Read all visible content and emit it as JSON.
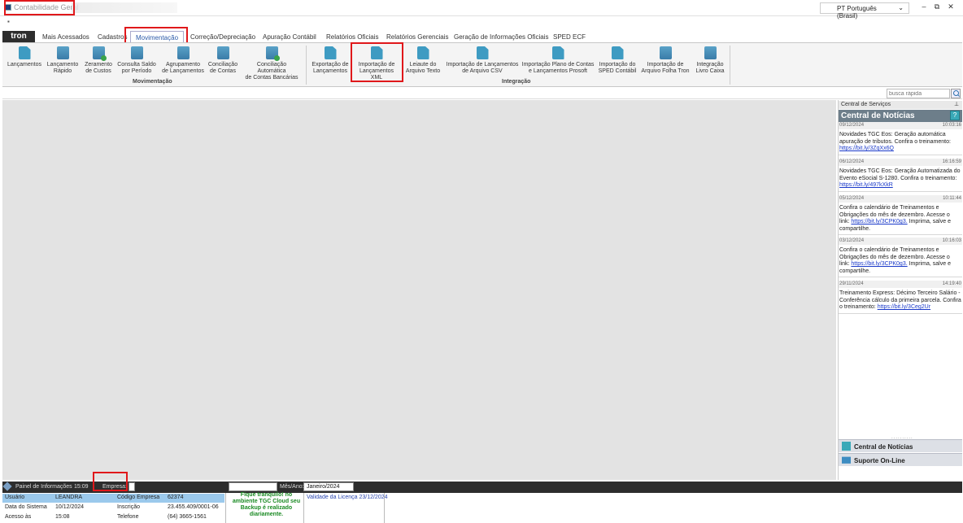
{
  "window": {
    "title": "Contabilidade Geral",
    "language": "PT Português (Brasil)",
    "minimize": "–",
    "restore": "⧉",
    "close": "✕"
  },
  "brand": "tron",
  "tabs": [
    {
      "label": "Mais Acessados"
    },
    {
      "label": "Cadastros"
    },
    {
      "label": "Movimentação",
      "active": true
    },
    {
      "label": "Correção/Depreciação"
    },
    {
      "label": "Apuração Contábil"
    },
    {
      "label": "Relatórios Oficiais"
    },
    {
      "label": "Relatórios Gerenciais"
    },
    {
      "label": "Geração de Informações Oficiais"
    },
    {
      "label": "SPED ECF"
    }
  ],
  "ribbon": {
    "movimentacao": {
      "label": "Movimentação",
      "buttons": [
        {
          "label": "Lançamentos",
          "icon": "lancamentos-icon"
        },
        {
          "label": "Lançamento\nRápido",
          "icon": "lancamento-rapido-icon"
        },
        {
          "label": "Zeramento\nde Custos",
          "icon": "zeramento-icon"
        },
        {
          "label": "Consulta Saldo\npor Período",
          "icon": "calendar-icon"
        },
        {
          "label": "Agrupamento\nde Lançamentos",
          "icon": "agrupamento-icon"
        },
        {
          "label": "Conciliação\nde Contas",
          "icon": "conciliacao-icon"
        },
        {
          "label": "Conciliação Automática\nde Contas Bancárias",
          "icon": "conciliacao-auto-icon"
        }
      ]
    },
    "integracao": {
      "label": "Integração",
      "buttons": [
        {
          "label": "Exportação de\nLançamentos",
          "icon": "exportacao-icon"
        },
        {
          "label": "Importação de\nLançamentos XML",
          "icon": "xml-icon"
        },
        {
          "label": "Leiaute do\nArquivo Texto",
          "icon": "txt-icon"
        },
        {
          "label": "Importação de Lançamentos\nde Arquivo CSV",
          "icon": "csv-icon"
        },
        {
          "label": "Importação Plano de Contas\ne Lançamentos Prosoft",
          "icon": "prosoft-icon"
        },
        {
          "label": "Importação do\nSPED Contábil",
          "icon": "sped-icon"
        },
        {
          "label": "Importação de\nArquivo Folha Tron",
          "icon": "folha-icon"
        },
        {
          "label": "Integração\nLivro Caixa",
          "icon": "livro-caixa-icon"
        }
      ]
    }
  },
  "quick_search": {
    "placeholder": "busca rápida"
  },
  "services": {
    "header": "Central de Serviços",
    "news_title": "Central de Notícias",
    "help_glyph": "?",
    "grip": "..........",
    "news": [
      {
        "date": "09/12/2024",
        "time": "10:03:16",
        "text": "Novidades TGC Eos: Geração automática apuração de tributos. Confira o treinamento:",
        "link": "https://bit.ly/3ZqXx6Q",
        "tail": ""
      },
      {
        "date": "06/12/2024",
        "time": "16:16:59",
        "text": "Novidades TGC Eos: Geração Automatizada do Evento eSocial S-1280. Confira o treinamento:",
        "link": "https://bit.ly/497kXkR",
        "tail": ""
      },
      {
        "date": "05/12/2024",
        "time": "10:11:44",
        "text": "Confira o calendário de Treinamentos e Obrigações do mês de dezembro. Acesse o link:",
        "link": "https://bit.ly/3CPK0g3.",
        "tail": " Imprima, salve e compartilhe."
      },
      {
        "date": "03/12/2024",
        "time": "10:16:03",
        "text": "Confira o calendário de Treinamentos e Obrigações do mês de dezembro. Acesse o link:",
        "link": "https://bit.ly/3CPK0g3.",
        "tail": " Imprima, salve e compartilhe."
      },
      {
        "date": "29/11/2024",
        "time": "14:19:40",
        "text": "Treinamento Express: Décimo Terceiro Salário - Conferência cálculo da primeira parcela. Confira o treinamento:",
        "link": "https://bit.ly/3Ceg2Ur",
        "tail": ""
      }
    ],
    "bottom_tabs": [
      {
        "label": "Central de Notícias"
      },
      {
        "label": "Suporte On-Line"
      }
    ]
  },
  "statusbar": {
    "panel_label": "Painel de Informações",
    "time": "15:09",
    "empresa_label": "Empresa:",
    "empresa_value": "",
    "mes_ano_label": "Mês/Ano:",
    "mes_ano_value": "Janeiro/2024"
  },
  "info": {
    "rows": [
      {
        "k1": "Usuário",
        "v1": "LEANDRA",
        "k2": "Código Empresa",
        "v2": "62374"
      },
      {
        "k1": "Data do Sistema",
        "v1": "10/12/2024",
        "k2": "Inscrição",
        "v2": "23.455.409/0001-06"
      },
      {
        "k1": "Acesso às",
        "v1": "15:08",
        "k2": "Telefone",
        "v2": "(64) 3665-1561"
      }
    ],
    "backup_msg": "Fique tranquilo! no ambiente TGC Cloud seu Backup é realizado diariamente.",
    "license": "Validade da Licença 23/12/2024"
  },
  "colors": {
    "accent": "#2b5aa8",
    "highlight_box": "#e0181b",
    "status_bar": "#2d2d2d",
    "news_header": "#6d7e8a",
    "selected_row": "#9bc9ec",
    "backup_text": "#1a8a23"
  }
}
